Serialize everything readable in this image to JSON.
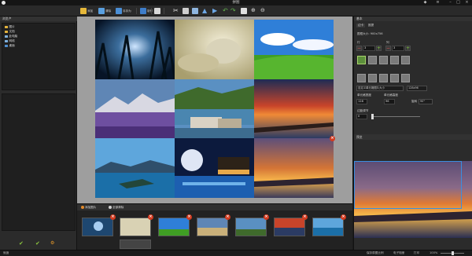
{
  "window": {
    "title": "拼图"
  },
  "toolbar": {
    "items": [
      {
        "label": "添加",
        "icon": "add-photo-icon",
        "color": "#e6b83a"
      },
      {
        "label": "清除",
        "icon": "clear-icon",
        "color": "#5aa0e0"
      },
      {
        "label": "另存为",
        "icon": "save-as-icon",
        "color": "#4b8fd6"
      },
      {
        "label": "制作",
        "icon": "make-icon",
        "color": "#3e7dc9"
      }
    ]
  },
  "left_panel": {
    "header": "浏览卢",
    "tree": [
      {
        "label": "图片",
        "level": 0
      },
      {
        "label": "文档",
        "level": 0
      },
      {
        "label": "此电脑",
        "level": 0
      },
      {
        "label": "网络",
        "level": 0
      },
      {
        "label": "桌面",
        "level": 0
      }
    ]
  },
  "strip": {
    "tab_add": "添加图片",
    "tab_clear": "全部清除"
  },
  "right_panel": {
    "header": "基本",
    "tabs": [
      "边卡",
      "圈提"
    ],
    "size_label": "图框大小: 900x756",
    "row_label": "行",
    "col_label": "列",
    "row_value": "3",
    "col_value": "3",
    "aspect_dropdown": "自定义单元格图片大小",
    "size_dropdown": "128x96",
    "cell_width_label": "单元格宽度",
    "cell_height_label": "单元格高度",
    "cell_width_value": "128",
    "cell_height_value": "96",
    "rotate_label": "旋转",
    "rotate_value": "90°",
    "spacing_label": "边距调节",
    "spacing_value": "0"
  },
  "preview_panel": {
    "header": "预览"
  },
  "status": {
    "left": "就绪",
    "items": [
      "保存原图比例",
      "电子相册",
      "打印"
    ],
    "zoom": "100%"
  }
}
